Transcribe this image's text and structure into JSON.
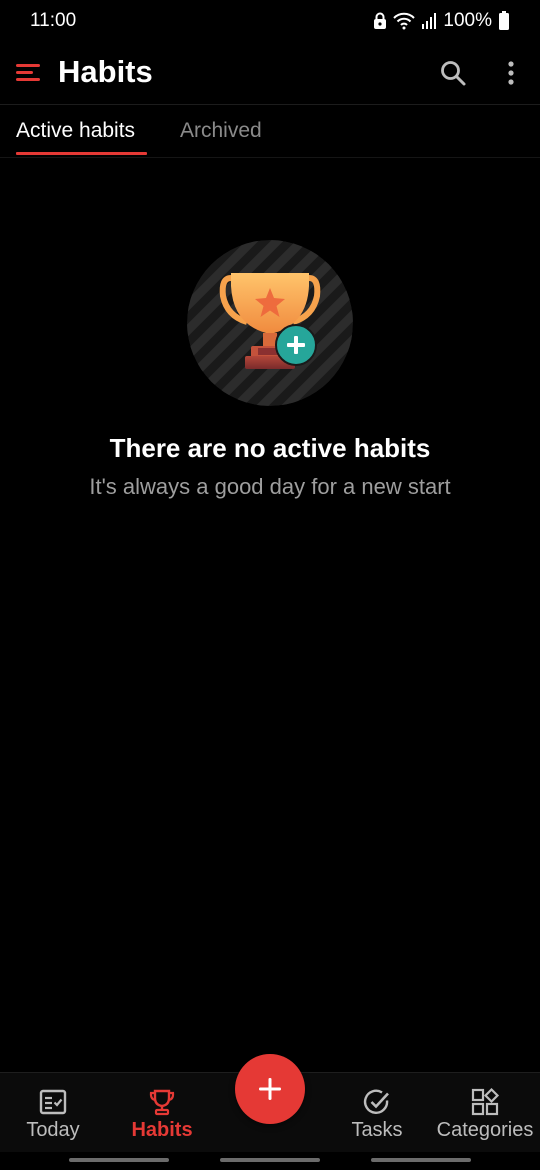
{
  "status_bar": {
    "time": "11:00",
    "battery": "100%",
    "icons": [
      "lock-icon",
      "wifi-icon",
      "signal-icon",
      "battery-icon"
    ]
  },
  "app_bar": {
    "title": "Habits",
    "icons": [
      "menu-icon",
      "search-icon",
      "more-vert-icon"
    ]
  },
  "tabs": [
    {
      "label": "Active habits",
      "selected": true
    },
    {
      "label": "Archived",
      "selected": false
    }
  ],
  "empty_state": {
    "illustration": "trophy-add-icon",
    "title": "There are no active habits",
    "subtitle": "It's always a good day for a new start"
  },
  "bottom_nav": {
    "items": [
      {
        "label": "Today",
        "icon": "today-icon",
        "active": false
      },
      {
        "label": "Habits",
        "icon": "trophy-icon",
        "active": true
      },
      {
        "label": "Tasks",
        "icon": "tasks-check-icon",
        "active": false
      },
      {
        "label": "Categories",
        "icon": "categories-icon",
        "active": false
      }
    ],
    "fab_icon": "plus-icon"
  },
  "colors": {
    "accent": "#e53935",
    "background": "#000000",
    "secondary_text": "#9e9e9e",
    "fab_badge": "#26a69a"
  }
}
